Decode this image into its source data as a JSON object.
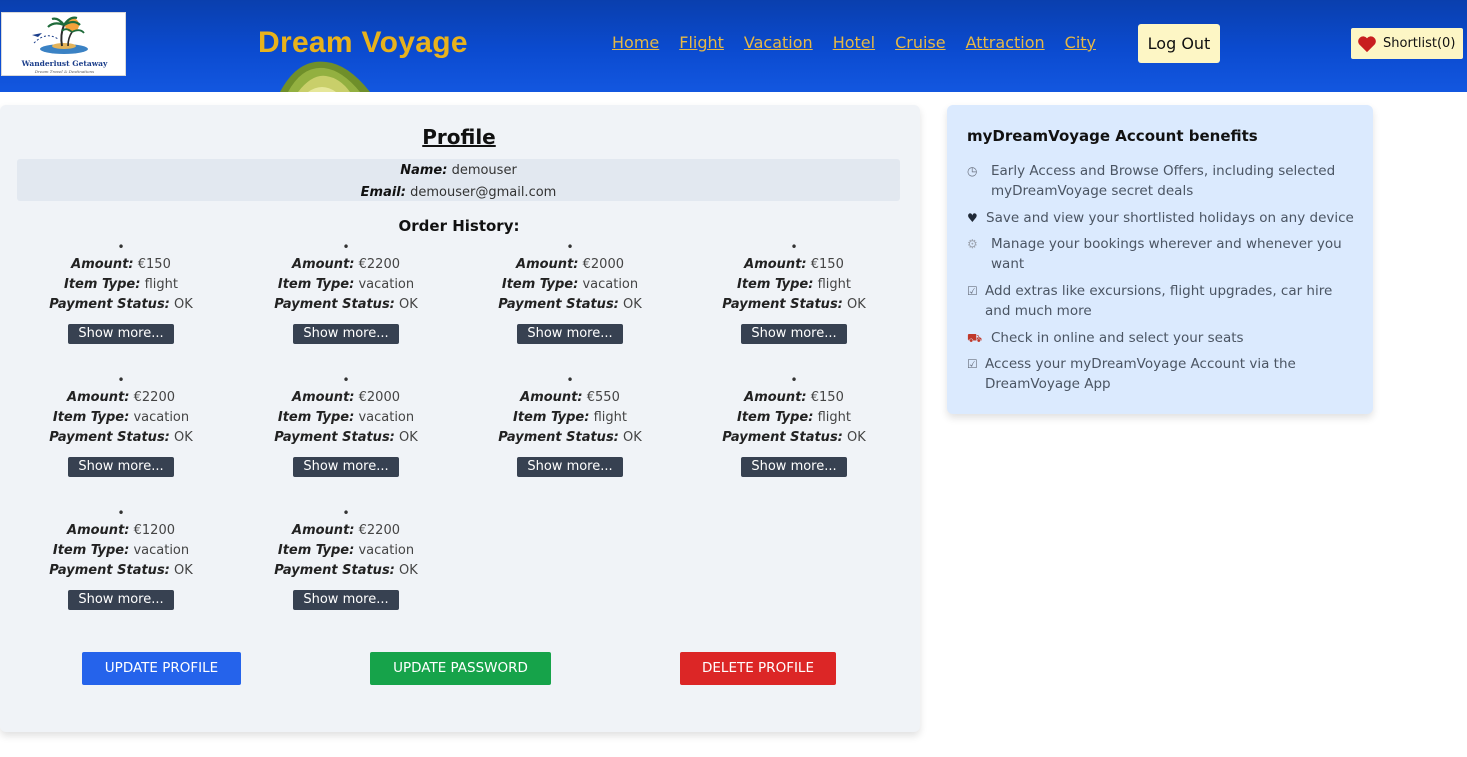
{
  "header": {
    "logo": {
      "title": "Wanderlust Getaway",
      "subtitle": "Dream Travel & Destinations"
    },
    "brand": "Dream Voyage",
    "nav": [
      "Home",
      "Flight",
      "Vacation",
      "Hotel",
      "Cruise",
      "Attraction",
      "City"
    ],
    "logout_label": "Log Out",
    "shortlist_label": "Shortlist(0)"
  },
  "profile": {
    "title": "Profile",
    "name_label": "Name:",
    "name_value": "demouser",
    "email_label": "Email:",
    "email_value": "demouser@gmail.com",
    "order_history_title": "Order History:",
    "labels": {
      "amount": "Amount:",
      "item_type": "Item Type:",
      "payment_status": "Payment Status:",
      "show_more": "Show more..."
    },
    "orders": [
      {
        "amount": "€150",
        "item_type": "flight",
        "payment_status": "OK"
      },
      {
        "amount": "€2200",
        "item_type": "vacation",
        "payment_status": "OK"
      },
      {
        "amount": "€2000",
        "item_type": "vacation",
        "payment_status": "OK"
      },
      {
        "amount": "€150",
        "item_type": "flight",
        "payment_status": "OK"
      },
      {
        "amount": "€2200",
        "item_type": "vacation",
        "payment_status": "OK"
      },
      {
        "amount": "€2000",
        "item_type": "vacation",
        "payment_status": "OK"
      },
      {
        "amount": "€550",
        "item_type": "flight",
        "payment_status": "OK"
      },
      {
        "amount": "€150",
        "item_type": "flight",
        "payment_status": "OK"
      },
      {
        "amount": "€1200",
        "item_type": "vacation",
        "payment_status": "OK"
      },
      {
        "amount": "€2200",
        "item_type": "vacation",
        "payment_status": "OK"
      }
    ],
    "buttons": {
      "update_profile": "UPDATE PROFILE",
      "update_password": "UPDATE PASSWORD",
      "delete_profile": "DELETE PROFILE"
    }
  },
  "benefits": {
    "title": "myDreamVoyage Account benefits",
    "items": [
      {
        "icon": "clock-icon",
        "text": "Early Access and Browse Offers, including selected myDreamVoyage secret deals"
      },
      {
        "icon": "heart-icon",
        "text": "Save and view your shortlisted holidays on any device"
      },
      {
        "icon": "gear-icon",
        "text": "Manage your bookings wherever and whenever you want"
      },
      {
        "icon": "checkbox-icon",
        "text": "Add extras like excursions, flight upgrades, car hire and much more"
      },
      {
        "icon": "car-icon",
        "text": "Check in online and select your seats"
      },
      {
        "icon": "checkbox-icon",
        "text": "Access your myDreamVoyage Account via the DreamVoyage App"
      }
    ]
  },
  "colors": {
    "header_blue": "#0b4bd0",
    "brand_gold": "#e8b21c",
    "update_blue": "#2563eb",
    "password_green": "#16a34a",
    "delete_red": "#dc2626",
    "benefits_bg": "#dbeafe"
  }
}
